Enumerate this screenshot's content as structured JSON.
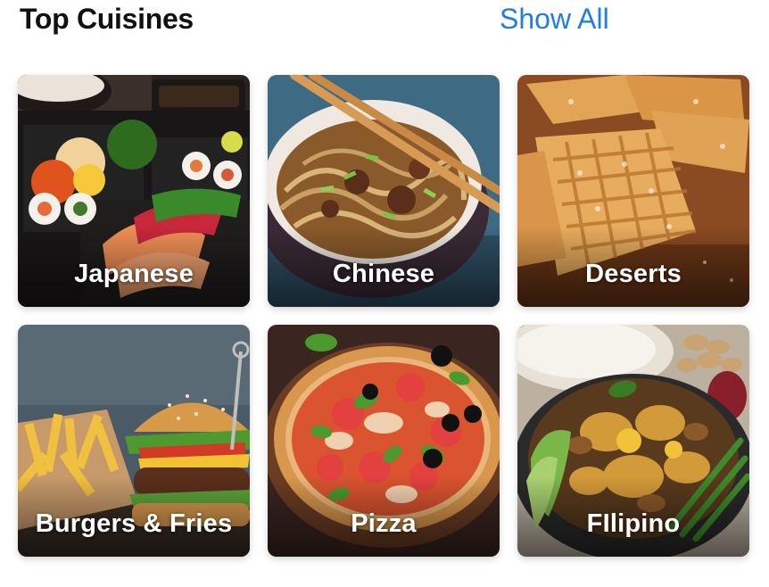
{
  "header": {
    "title": "Top Cuisines",
    "show_all_label": "Show All",
    "accent_color": "#1e7ee6"
  },
  "cuisines": [
    {
      "label": "Japanese",
      "image": "bento-box-image"
    },
    {
      "label": "Chinese",
      "image": "noodle-bowl-image"
    },
    {
      "label": "Deserts",
      "image": "waffles-image"
    },
    {
      "label": "Burgers & Fries",
      "image": "burger-fries-image"
    },
    {
      "label": "Pizza",
      "image": "pizza-image"
    },
    {
      "label": "FIlipino",
      "image": "filipino-stew-image"
    }
  ]
}
